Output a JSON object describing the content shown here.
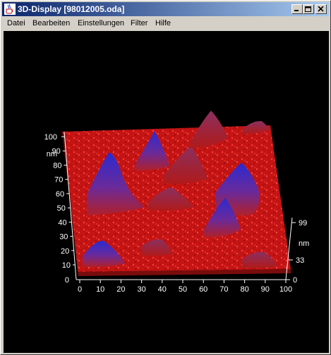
{
  "window": {
    "title": "3D-Display [98012005.oda]",
    "buttons": [
      "minimize",
      "maximize",
      "close"
    ]
  },
  "menu": [
    {
      "label": "Datei"
    },
    {
      "label": "Bearbeiten"
    },
    {
      "label": "Einstellungen"
    },
    {
      "label": "Filter"
    },
    {
      "label": "Hilfe"
    }
  ],
  "plot": {
    "background": "#000000",
    "surface_color": "#cc1a1a",
    "peak_color": "#2a2ad0",
    "axis_color": "#ffffff",
    "x_ticks": [
      "0",
      "10",
      "20",
      "30",
      "40",
      "50",
      "60",
      "70",
      "80",
      "90",
      "100"
    ],
    "y_ticks": [
      "10",
      "20",
      "30",
      "40",
      "50",
      "60",
      "70",
      "80",
      "90",
      "100"
    ],
    "y_unit": "nm",
    "z_ticks": [
      "0",
      "33",
      "99"
    ],
    "z_unit": "nm"
  }
}
